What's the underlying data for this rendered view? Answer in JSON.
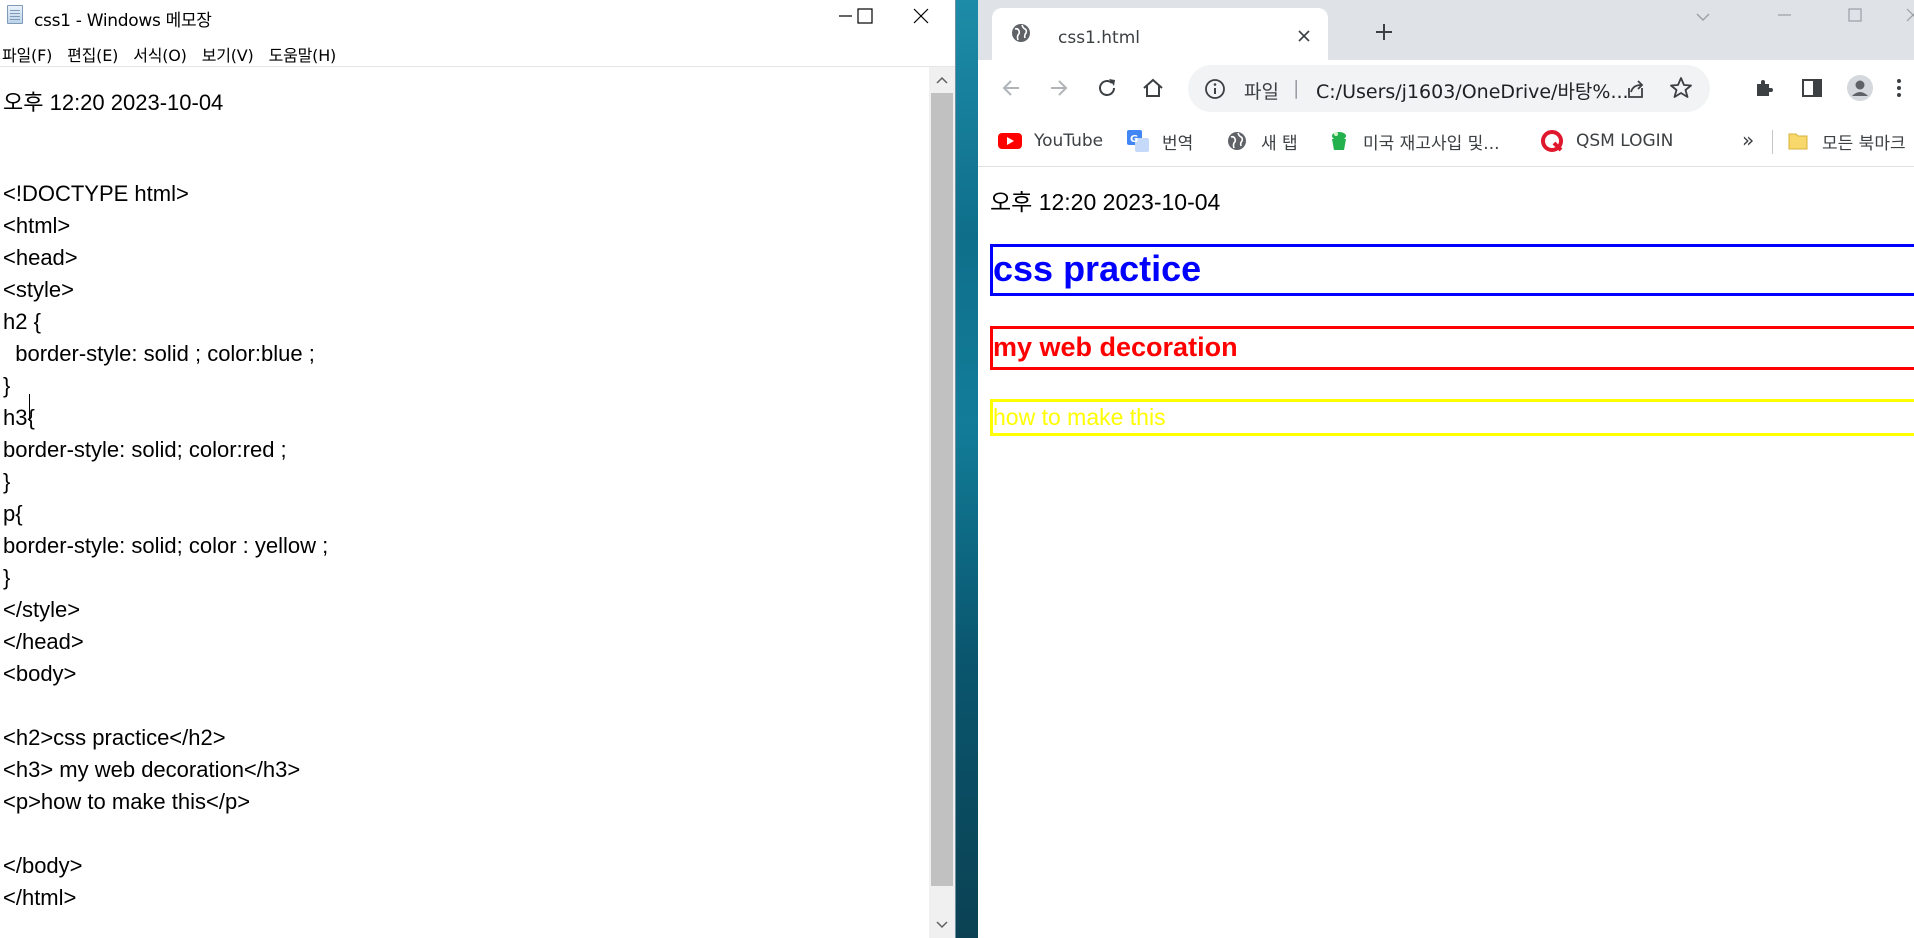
{
  "notepad": {
    "title": "css1 - Windows 메모장",
    "menu": [
      "파일(F)",
      "편집(E)",
      "서식(O)",
      "보기(V)",
      "도움말(H)"
    ],
    "lines": [
      "오후 12:20 2023-10-04",
      "",
      "",
      "<!DOCTYPE html>",
      "<html>",
      "<head>",
      "<style>",
      "h2 {",
      "  border-style: solid ; color:blue ;",
      "}",
      "h3{",
      "border-style: solid; color:red ;",
      "}",
      "p{",
      "border-style: solid; color : yellow ;",
      "}",
      "</style>",
      "</head>",
      "<body>",
      "",
      "<h2>css practice</h2>",
      "<h3> my web decoration</h3>",
      "<p>how to make this</p>",
      "",
      "</body>",
      "</html>"
    ]
  },
  "browser": {
    "tab_title": "css1.html",
    "omnibox": {
      "scheme_label": "파일",
      "separator": "|",
      "url": "C:/Users/j1603/OneDrive/바탕%..."
    },
    "bookmarks": [
      {
        "label": "YouTube",
        "icon": "youtube-icon"
      },
      {
        "label": "번역",
        "icon": "translate-icon"
      },
      {
        "label": "새 탭",
        "icon": "globe-icon"
      },
      {
        "label": "미국 재고사입 및...",
        "icon": "cup-icon"
      },
      {
        "label": "QSM LOGIN",
        "icon": "qsm-icon"
      }
    ],
    "bookmarks_more": "»",
    "bookmarks_folder": "모든 북마크",
    "page": {
      "timestamp": "오후 12:20 2023-10-04",
      "h2": "css practice",
      "h3": "my web decoration",
      "p": "how to make this",
      "colors": {
        "h2": "#0000ff",
        "h3": "#ff0000",
        "p": "#ffff00"
      }
    }
  }
}
